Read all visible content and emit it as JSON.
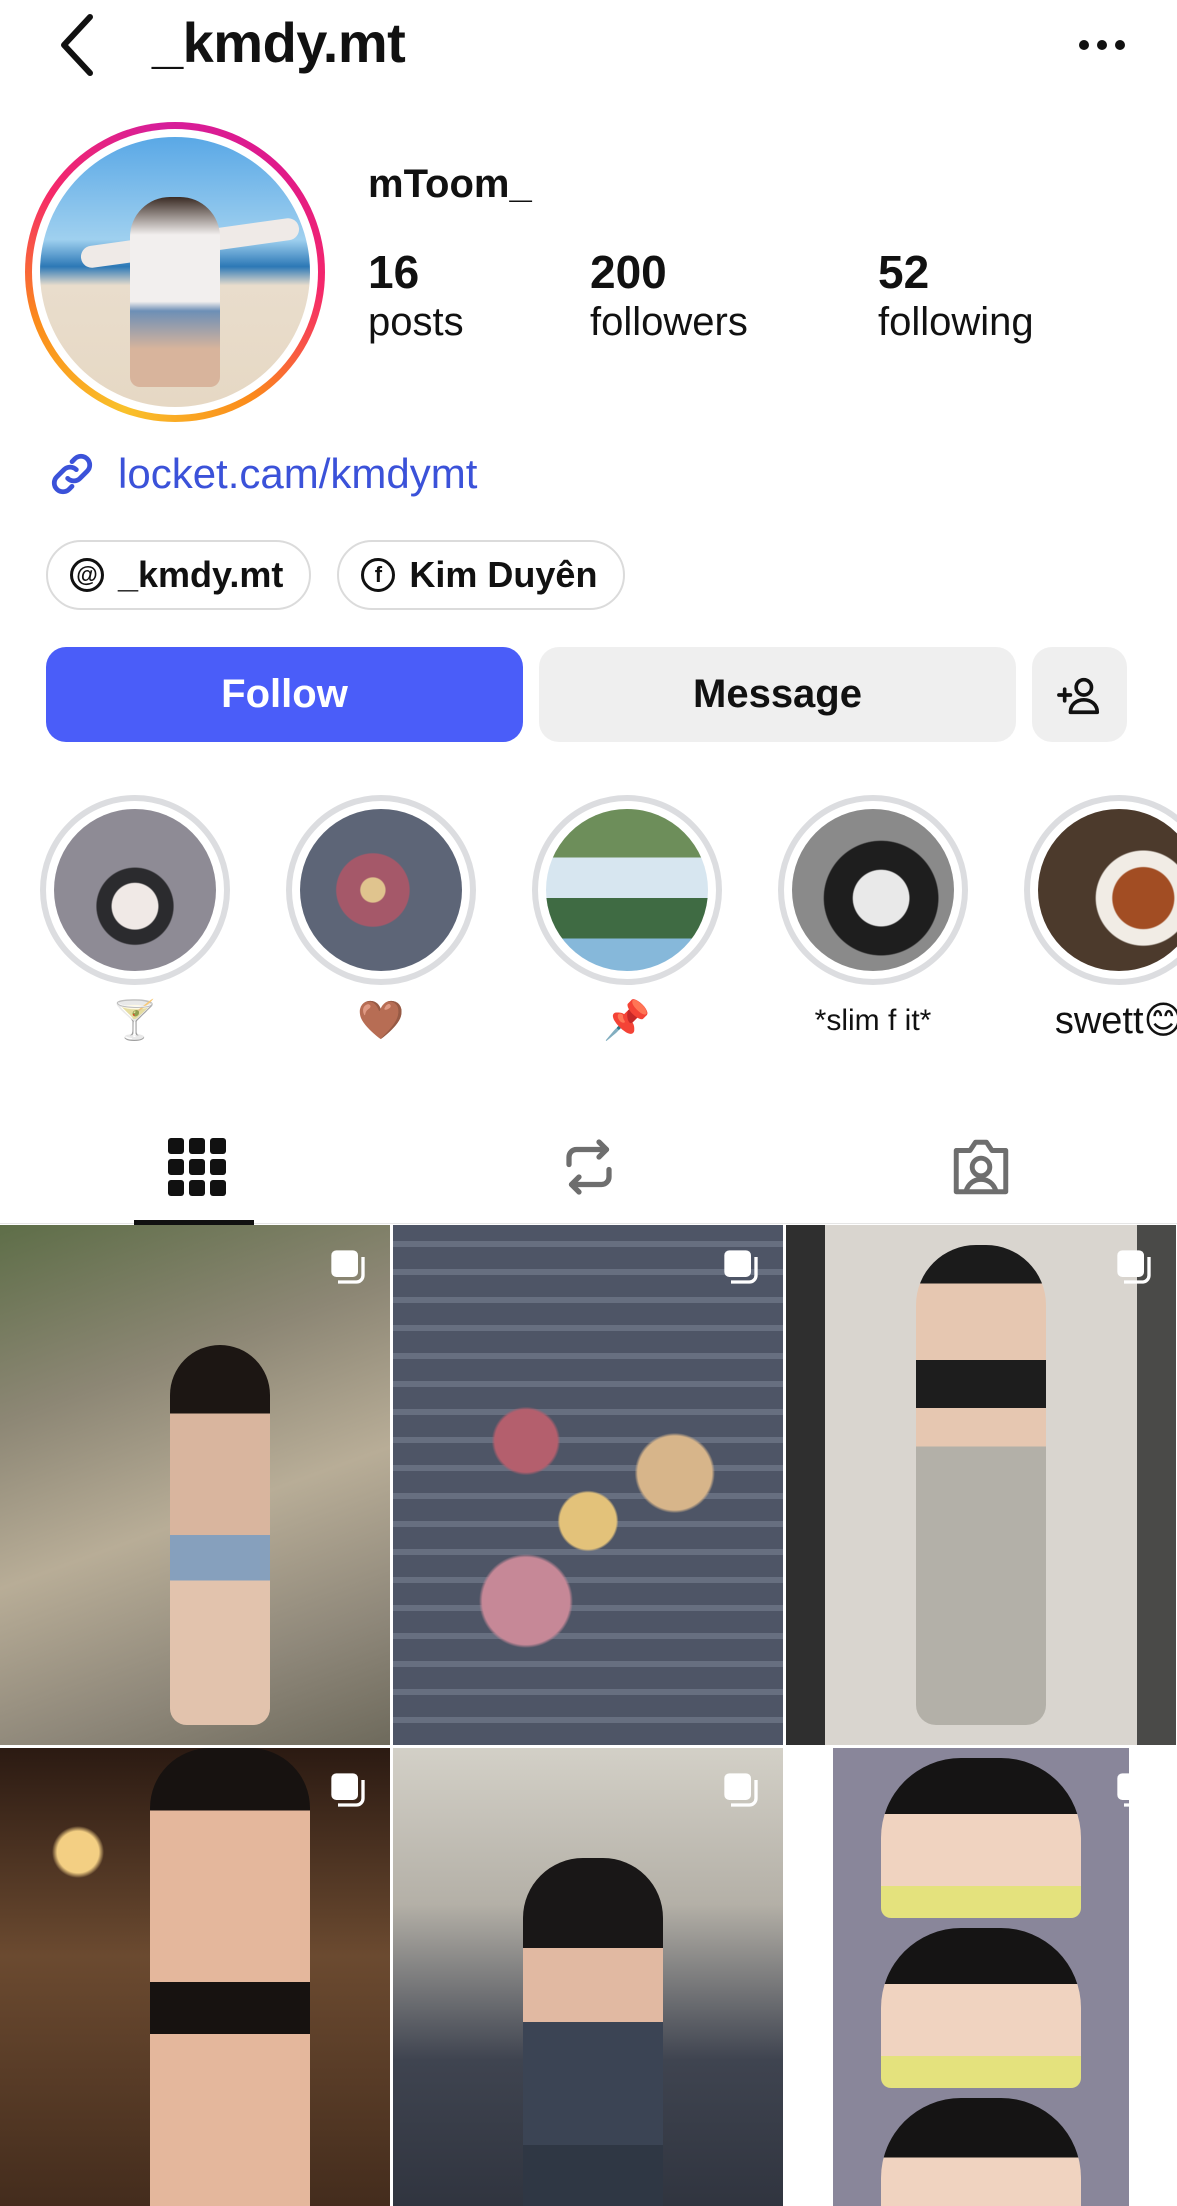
{
  "header": {
    "username": "_kmdy.mt"
  },
  "profile": {
    "display_name": "mToom_",
    "stats": {
      "posts_count": "16",
      "posts_label": "posts",
      "followers_count": "200",
      "followers_label": "followers",
      "following_count": "52",
      "following_label": "following"
    },
    "link": "locket.cam/kmdymt",
    "chips": [
      {
        "label": "_kmdy.mt",
        "icon": "threads-icon"
      },
      {
        "label": "Kim Duyên",
        "icon": "facebook-icon"
      }
    ]
  },
  "actions": {
    "follow_label": "Follow",
    "message_label": "Message"
  },
  "highlights": [
    {
      "label": "🍸"
    },
    {
      "label": "🤎"
    },
    {
      "label": "📌"
    },
    {
      "label": "*slim f it*"
    },
    {
      "label": "swett😊"
    }
  ],
  "tabs": [
    "grid-icon",
    "reposts-icon",
    "tagged-icon"
  ],
  "colors": {
    "accent": "#4a5df9",
    "link": "#3b52d9",
    "button_secondary": "#efefef"
  }
}
